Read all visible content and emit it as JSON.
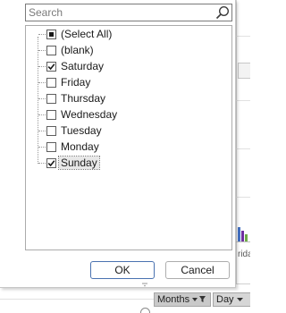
{
  "filter": {
    "search": {
      "placeholder": "Search",
      "value": ""
    },
    "items": [
      {
        "label": "(Select All)",
        "state": "indeterminate"
      },
      {
        "label": "(blank)",
        "state": "unchecked"
      },
      {
        "label": "Saturday",
        "state": "checked"
      },
      {
        "label": "Friday",
        "state": "unchecked"
      },
      {
        "label": "Thursday",
        "state": "unchecked"
      },
      {
        "label": "Wednesday",
        "state": "unchecked"
      },
      {
        "label": "Tuesday",
        "state": "unchecked"
      },
      {
        "label": "Monday",
        "state": "unchecked"
      },
      {
        "label": "Sunday",
        "state": "checked"
      }
    ],
    "ok_label": "OK",
    "cancel_label": "Cancel"
  },
  "pivot": {
    "fields": [
      {
        "label": "Months",
        "icon": "filter-active-icon"
      },
      {
        "label": "Day",
        "icon": "dropdown-arrow-icon"
      }
    ]
  },
  "chart": {
    "partial_label": "rida",
    "bar_colors": [
      "#4472c4",
      "#ed7d31",
      "#a5a5a5",
      "#7030a0",
      "#70ad47"
    ]
  },
  "colors": {
    "panel_border": "#c6c6c6",
    "ok_border": "#4a72b0",
    "selected_item_bg": "#e8e8e8"
  }
}
